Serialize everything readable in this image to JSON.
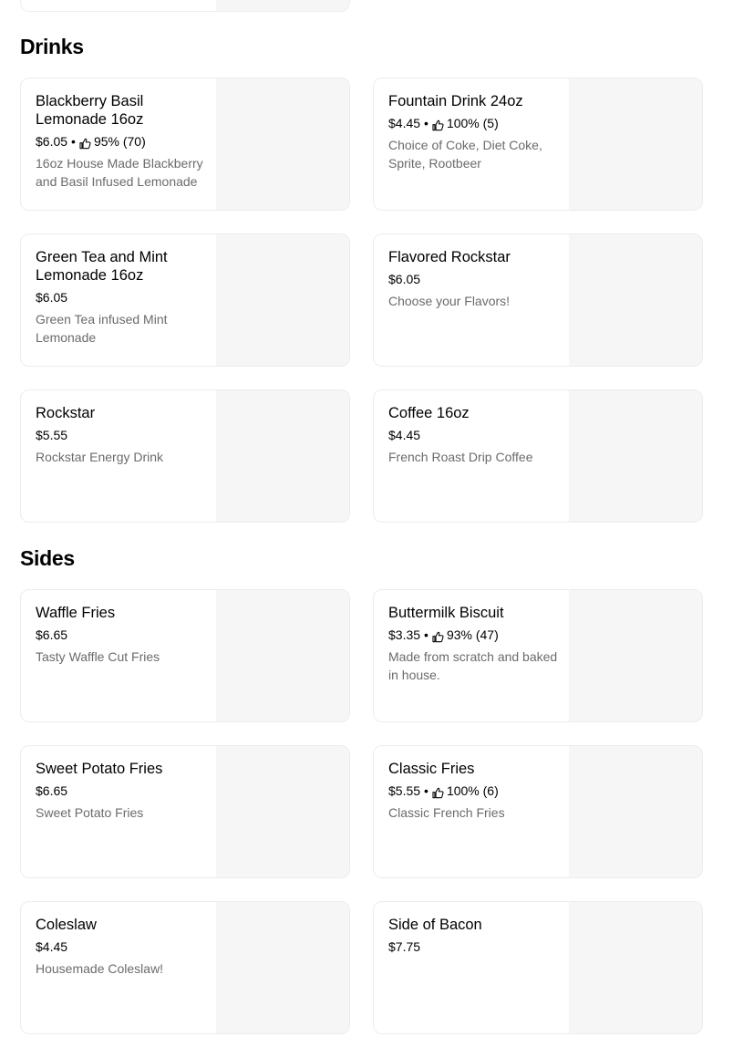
{
  "sections": [
    {
      "title": "Drinks",
      "items": [
        {
          "name": "Blackberry Basil Lemonade 16oz",
          "price": "$6.05",
          "rating": "95% (70)",
          "description": "16oz House Made Blackberry and Basil Infused Lemonade"
        },
        {
          "name": "Fountain Drink 24oz",
          "price": "$4.45",
          "rating": "100% (5)",
          "description": "Choice of Coke, Diet Coke, Sprite, Rootbeer"
        },
        {
          "name": "Green Tea and Mint Lemonade 16oz",
          "price": "$6.05",
          "rating": "",
          "description": "Green Tea infused Mint Lemonade"
        },
        {
          "name": "Flavored Rockstar",
          "price": "$6.05",
          "rating": "",
          "description": "Choose your Flavors!"
        },
        {
          "name": "Rockstar",
          "price": "$5.55",
          "rating": "",
          "description": "Rockstar Energy Drink"
        },
        {
          "name": "Coffee 16oz",
          "price": "$4.45",
          "rating": "",
          "description": "French Roast Drip Coffee"
        }
      ]
    },
    {
      "title": "Sides",
      "items": [
        {
          "name": "Waffle Fries",
          "price": "$6.65",
          "rating": "",
          "description": "Tasty Waffle Cut Fries"
        },
        {
          "name": "Buttermilk Biscuit",
          "price": "$3.35",
          "rating": "93% (47)",
          "description": "Made from scratch and baked in house."
        },
        {
          "name": "Sweet Potato Fries",
          "price": "$6.65",
          "rating": "",
          "description": "Sweet Potato Fries"
        },
        {
          "name": "Classic Fries",
          "price": "$5.55",
          "rating": "100% (6)",
          "description": "Classic French Fries"
        },
        {
          "name": "Coleslaw",
          "price": "$4.45",
          "rating": "",
          "description": "Housemade Coleslaw!"
        },
        {
          "name": "Side of Bacon",
          "price": "$7.75",
          "rating": "",
          "description": ""
        }
      ]
    }
  ],
  "icons": {
    "rating": "thumbs-up-icon"
  },
  "colors": {
    "card_border": "#ececec",
    "image_placeholder": "#f6f6f6",
    "description_text": "#6b6b6b"
  }
}
